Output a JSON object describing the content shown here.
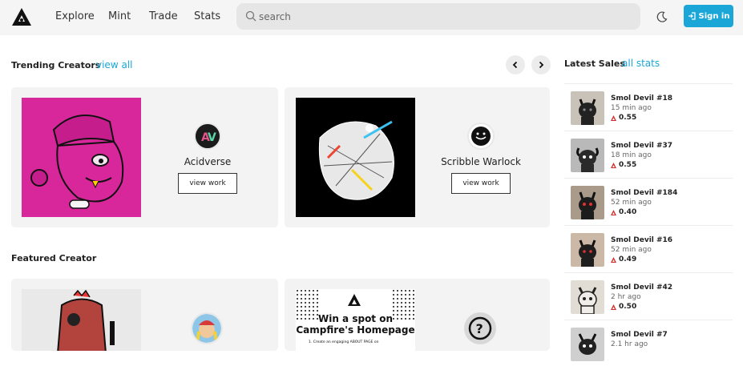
{
  "nav": {
    "explore": "Explore",
    "mint": "Mint",
    "trade": "Trade",
    "stats": "Stats"
  },
  "search": {
    "placeholder": "search"
  },
  "signin": {
    "label": "Sign in"
  },
  "trending": {
    "title": "Trending Creators",
    "view_all": "view all",
    "creators": [
      {
        "name": "Acidverse",
        "button": "view work"
      },
      {
        "name": "Scribble Warlock",
        "button": "view work"
      }
    ]
  },
  "featured": {
    "title": "Featured Creator",
    "banner_line1": "Win a spot on",
    "banner_line2": "Campfire's Homepage",
    "banner_line3": "1.  Create an engaging ABOUT PAGE on"
  },
  "latest_sales": {
    "title": "Latest Sales",
    "all_stats": "all stats",
    "items": [
      {
        "name": "Smol Devil #18",
        "time": "15 min ago",
        "price": "0.55"
      },
      {
        "name": "Smol Devil #37",
        "time": "18 min ago",
        "price": "0.55"
      },
      {
        "name": "Smol Devil #184",
        "time": "52 min ago",
        "price": "0.40"
      },
      {
        "name": "Smol Devil #16",
        "time": "52 min ago",
        "price": "0.49"
      },
      {
        "name": "Smol Devil #42",
        "time": "2 hr ago",
        "price": "0.50"
      },
      {
        "name": "Smol Devil #7",
        "time": "2.1 hr ago",
        "price": ""
      }
    ]
  },
  "colors": {
    "accent": "#1aa7d8",
    "price_icon": "#d62b2b"
  }
}
